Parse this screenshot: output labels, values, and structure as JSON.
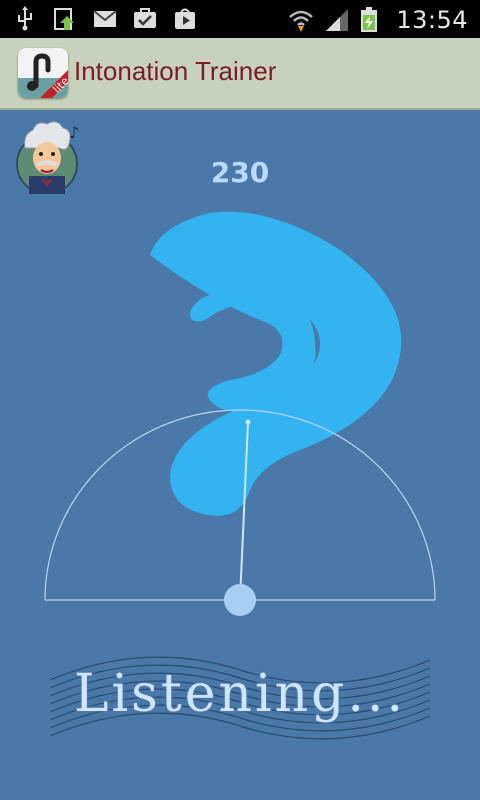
{
  "status_bar": {
    "time": "13:54",
    "icons": [
      "usb-icon",
      "upload-icon",
      "gmail-icon",
      "task-icon",
      "play-store-icon",
      "wifi-icon",
      "signal-icon",
      "battery-icon"
    ]
  },
  "action_bar": {
    "title": "Intonation Trainer",
    "app_icon_badge": "lite",
    "title_color": "#7a1d25",
    "background": "#c8d1bb"
  },
  "main": {
    "pitch_value": "230",
    "status_text": "Listening...",
    "needle_deviation": 0,
    "accent": "#33b3f0",
    "background": "#4a79a9"
  }
}
